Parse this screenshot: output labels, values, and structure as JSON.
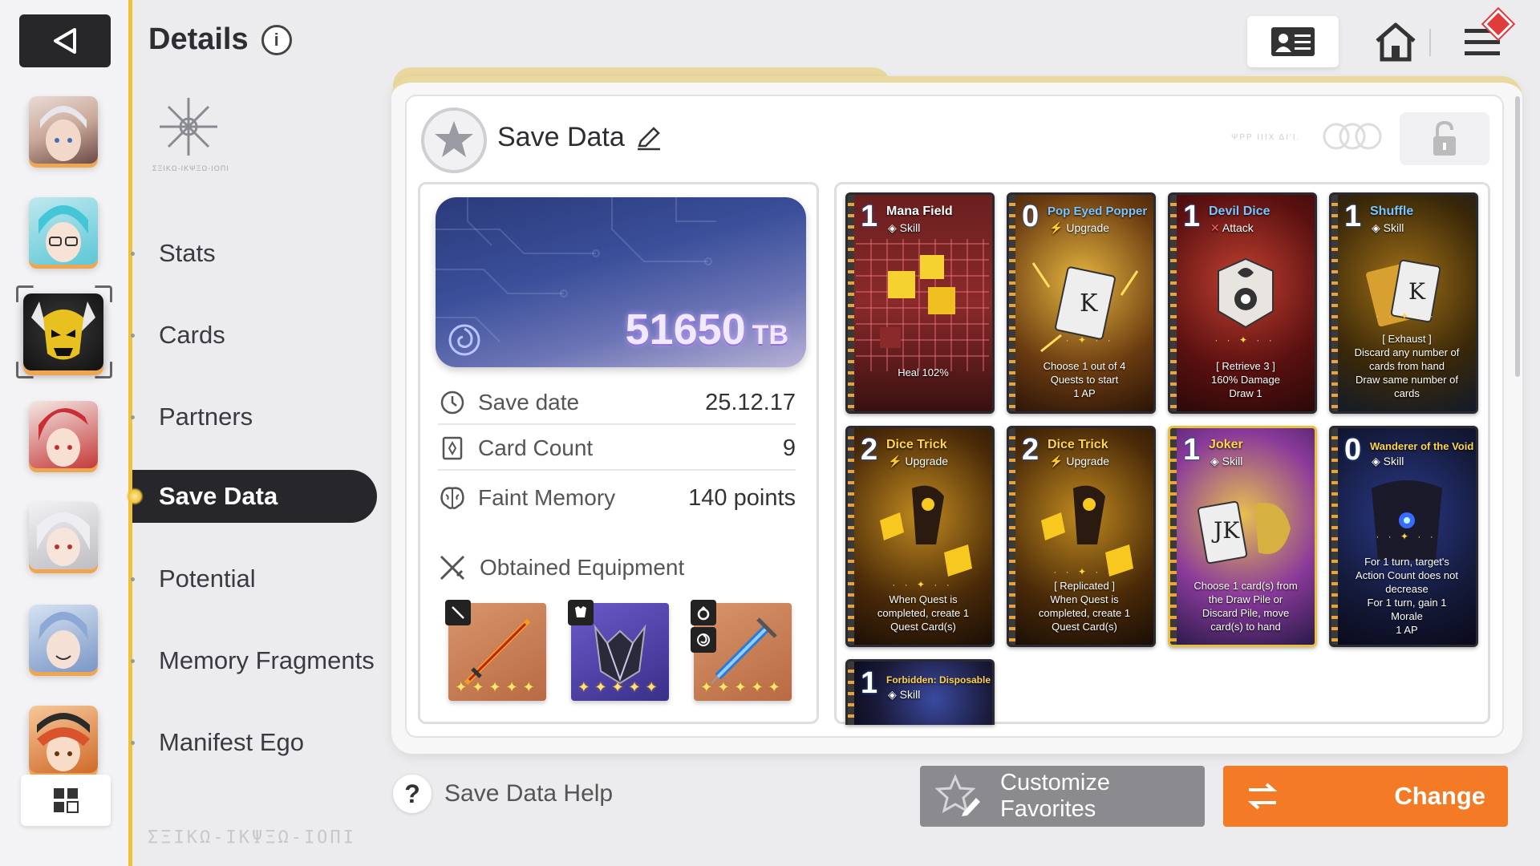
{
  "header": {
    "title": "Details",
    "info_icon": "i",
    "emblem_text": "ΣΞΙΚΩ-ΙΚΨΞΩ-ΙΟΠΙ"
  },
  "menu": {
    "items": [
      "Stats",
      "Cards",
      "Partners",
      "Save Data",
      "Potential",
      "Memory Fragments",
      "Manifest Ego"
    ],
    "active": "Save Data"
  },
  "footer_logo": "ΣΞΙΚΩ-ΙΚΨΞΩ-ΙΟΠΙ",
  "save_data": {
    "title": "Save Data",
    "tb_value": "51650",
    "tb_unit": "TB",
    "faint_code": "ΨΡΡ ΙΙΙΧ ΔΙ'Ι.",
    "stats": [
      {
        "label": "Save date",
        "value": "25.12.17"
      },
      {
        "label": "Card Count",
        "value": "9"
      },
      {
        "label": "Faint Memory",
        "value": "140 points"
      }
    ],
    "equipment_title": "Obtained Equipment",
    "equipment": [
      {
        "type": "sword",
        "stars": "✦✦✦✦✦"
      },
      {
        "type": "armor",
        "stars": "✦✦✦✦✦"
      },
      {
        "type": "ring",
        "stars": "✦✦✦✦✦"
      }
    ]
  },
  "cards": [
    {
      "cost": "1",
      "name": "Mana Field",
      "type": "Skill",
      "desc": "Heal 102%",
      "deco": "",
      "name_color": "white"
    },
    {
      "cost": "0",
      "name": "Pop Eyed Popper",
      "type": "Upgrade",
      "desc": "Choose 1 out of 4\nQuests to start\n1 AP",
      "deco": "· · ✦ · ·",
      "name_color": "blue"
    },
    {
      "cost": "1",
      "name": "Devil Dice",
      "type": "Attack",
      "desc": "[ Retrieve 3 ]\n160% Damage\nDraw 1",
      "deco": "· · ✦ · ·",
      "name_color": "blue"
    },
    {
      "cost": "1",
      "name": "Shuffle",
      "type": "Skill",
      "desc": "[ Exhaust ]\nDiscard any number of\ncards from hand\nDraw same number of\ncards",
      "deco": "· · ✦ · ·",
      "name_color": "blue"
    },
    {
      "cost": "2",
      "name": "Dice Trick",
      "type": "Upgrade",
      "desc": "When Quest is\ncompleted, create 1\nQuest Card(s)",
      "deco": "· · ✦ · ·",
      "name_color": "yellow"
    },
    {
      "cost": "2",
      "name": "Dice Trick",
      "type": "Upgrade",
      "desc": "[ Replicated ]\nWhen Quest is\ncompleted, create 1\nQuest Card(s)",
      "deco": "· · ✦ · ·",
      "name_color": "yellow"
    },
    {
      "cost": "1",
      "name": "Joker",
      "type": "Skill",
      "desc": "Choose 1 card(s) from\nthe Draw Pile or\nDiscard Pile, move\ncard(s) to hand",
      "deco": "",
      "name_color": "yellow"
    },
    {
      "cost": "0",
      "name": "Wanderer of the Void",
      "type": "Skill",
      "desc": "For 1 turn, target's\nAction Count does not\ndecrease\nFor 1 turn, gain 1\nMorale\n1 AP",
      "deco": "· · ✦ · ·",
      "name_color": "yellow"
    },
    {
      "cost": "1",
      "name": "Forbidden: Disposable Ego",
      "type": "Skill",
      "desc": "",
      "deco": "",
      "name_color": "yellow"
    }
  ],
  "footer": {
    "help_label": "Save Data Help",
    "help_icon": "?",
    "favorites_label": "Customize Favorites",
    "change_label": "Change"
  },
  "colors": {
    "accent_orange": "#f57a25",
    "gold_line": "#f0c23a",
    "dark_pill": "#26262b"
  },
  "icons": [
    "back-arrow-icon",
    "grid-icon",
    "profile-card-icon",
    "home-icon",
    "hamburger-icon",
    "pencil-icon",
    "lock-icon",
    "clock-icon",
    "card-icon",
    "brain-icon",
    "swords-icon",
    "star-pencil-icon",
    "swap-icon"
  ]
}
